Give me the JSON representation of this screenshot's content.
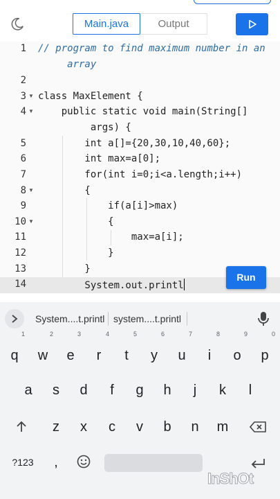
{
  "header": {
    "tabs": [
      {
        "label": "Main.java"
      },
      {
        "label": "Output"
      }
    ]
  },
  "editor": {
    "lines": [
      {
        "num": "1",
        "text": "// program to find maximum number in an"
      },
      {
        "num": "",
        "text": "     array"
      },
      {
        "num": "2",
        "text": ""
      },
      {
        "num": "3",
        "text": "class MaxElement {"
      },
      {
        "num": "4",
        "text": "    public static void main(String[]"
      },
      {
        "num": "",
        "text": "         args) {"
      },
      {
        "num": "5",
        "text": "        int a[]={20,30,10,40,60};"
      },
      {
        "num": "6",
        "text": "        int max=a[0];"
      },
      {
        "num": "7",
        "text": "        for(int i=0;i<a.length;i++)"
      },
      {
        "num": "8",
        "text": "        {"
      },
      {
        "num": "9",
        "text": "            if(a[i]>max)"
      },
      {
        "num": "10",
        "text": "            {"
      },
      {
        "num": "11",
        "text": "                max=a[i];"
      },
      {
        "num": "12",
        "text": "            }"
      },
      {
        "num": "13",
        "text": "        }"
      },
      {
        "num": "14",
        "text": "        System.out.printl"
      }
    ],
    "run_label": "Run"
  },
  "keyboard": {
    "suggestions": [
      "System....t.printl",
      "system....t.printl"
    ],
    "row1": [
      {
        "k": "q",
        "h": "1"
      },
      {
        "k": "w",
        "h": "2"
      },
      {
        "k": "e",
        "h": "3"
      },
      {
        "k": "r",
        "h": "4"
      },
      {
        "k": "t",
        "h": "5"
      },
      {
        "k": "y",
        "h": "6"
      },
      {
        "k": "u",
        "h": "7"
      },
      {
        "k": "i",
        "h": "8"
      },
      {
        "k": "o",
        "h": "9"
      },
      {
        "k": "p",
        "h": "0"
      }
    ],
    "row2": [
      "a",
      "s",
      "d",
      "f",
      "g",
      "h",
      "j",
      "k",
      "l"
    ],
    "row3": [
      "z",
      "x",
      "c",
      "v",
      "b",
      "n",
      "m"
    ],
    "symbols_label": "?123",
    "comma": ","
  },
  "watermark": "InShOt"
}
